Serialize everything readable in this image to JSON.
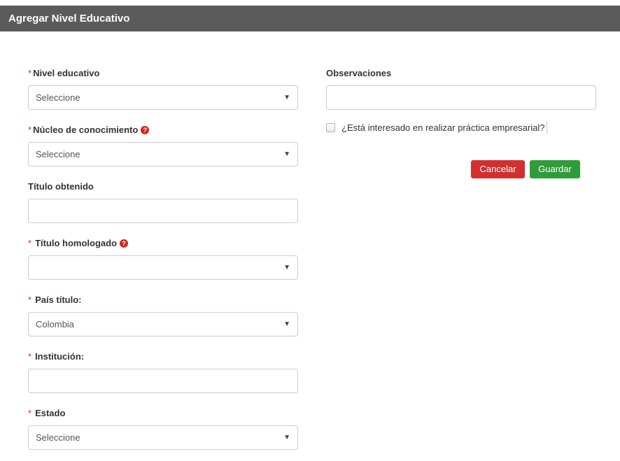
{
  "header": {
    "title": "Agregar Nivel Educativo"
  },
  "form": {
    "nivel_educativo": {
      "required_mark": "*",
      "label": "Nivel educativo",
      "value": "Seleccione"
    },
    "nucleo_conocimiento": {
      "required_mark": "*",
      "label": "Núcleo de conocimiento",
      "value": "Seleccione",
      "help_icon": "question-circle-icon"
    },
    "titulo_obtenido": {
      "label": "Título obtenido",
      "value": ""
    },
    "titulo_homologado": {
      "required_mark": "*",
      "label": "Título homologado",
      "value": "",
      "help_icon": "question-circle-icon"
    },
    "pais_titulo": {
      "required_mark": "*",
      "label": "País título:",
      "value": "Colombia"
    },
    "institucion": {
      "required_mark": "*",
      "label": "Institución:",
      "value": ""
    },
    "estado": {
      "required_mark": "*",
      "label": "Estado",
      "value": "Seleccione"
    },
    "observaciones": {
      "label": "Observaciones",
      "value": ""
    },
    "practica_empresarial": {
      "label": "¿Está interesado en realizar práctica empresarial?",
      "checked": false
    }
  },
  "actions": {
    "cancel_label": "Cancelar",
    "save_label": "Guardar"
  },
  "colors": {
    "header_bg": "#5b5b5b",
    "cancel": "#d32f2f",
    "save": "#2e9c38",
    "required": "#c9302c"
  },
  "icons": {
    "select_arrow": "triangle-down-icon",
    "help": "question-circle-icon"
  }
}
